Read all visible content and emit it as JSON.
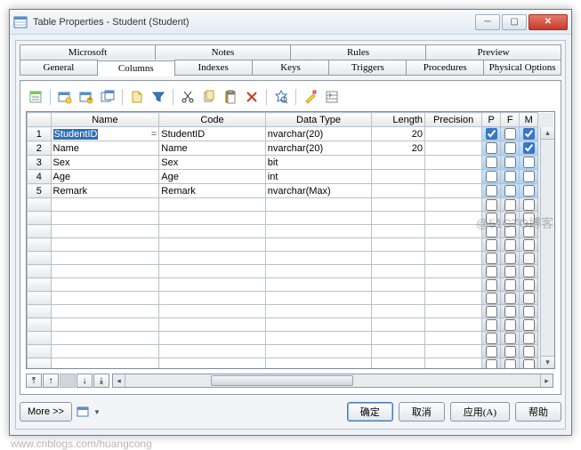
{
  "window": {
    "title": "Table Properties - Student (Student)"
  },
  "tabs_row1": [
    "Microsoft",
    "Notes",
    "Rules",
    "Preview"
  ],
  "tabs_row2": [
    "General",
    "Columns",
    "Indexes",
    "Keys",
    "Triggers",
    "Procedures",
    "Physical Options"
  ],
  "active_tab": "Columns",
  "columns": {
    "headers": {
      "name": "Name",
      "code": "Code",
      "datatype": "Data Type",
      "length": "Length",
      "precision": "Precision",
      "p": "P",
      "f": "F",
      "m": "M"
    },
    "rows": [
      {
        "n": 1,
        "name": "StudentID",
        "code": "StudentID",
        "datatype": "nvarchar(20)",
        "length": "20",
        "precision": "",
        "p": true,
        "f": false,
        "m": true,
        "selected": true,
        "eq": true
      },
      {
        "n": 2,
        "name": "Name",
        "code": "Name",
        "datatype": "nvarchar(20)",
        "length": "20",
        "precision": "",
        "p": false,
        "f": false,
        "m": true
      },
      {
        "n": 3,
        "name": "Sex",
        "code": "Sex",
        "datatype": "bit",
        "length": "",
        "precision": "",
        "p": false,
        "f": false,
        "m": false
      },
      {
        "n": 4,
        "name": "Age",
        "code": "Age",
        "datatype": "int",
        "length": "",
        "precision": "",
        "p": false,
        "f": false,
        "m": false
      },
      {
        "n": 5,
        "name": "Remark",
        "code": "Remark",
        "datatype": "nvarchar(Max)",
        "length": "",
        "precision": "",
        "p": false,
        "f": false,
        "m": false
      }
    ],
    "empty_rows": 14
  },
  "buttons": {
    "more": "More >>",
    "ok": "确定",
    "cancel": "取消",
    "apply": "应用(A)",
    "help": "帮助"
  },
  "watermark": "@51CTO博客",
  "footer_url": "www.cnblogs.com/huangcong"
}
